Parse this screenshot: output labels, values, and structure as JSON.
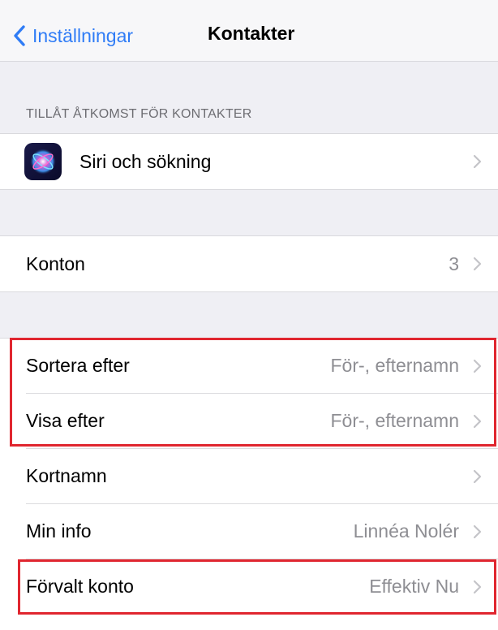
{
  "nav": {
    "back_label": "Inställningar",
    "title": "Kontakter"
  },
  "section_header": "TILLÅT ÅTKOMST FÖR KONTAKTER",
  "siri_row": {
    "label": "Siri och sökning"
  },
  "accounts_row": {
    "label": "Konton",
    "value": "3"
  },
  "settings_rows": [
    {
      "label": "Sortera efter",
      "value": "För-, efternamn"
    },
    {
      "label": "Visa efter",
      "value": "För-, efternamn"
    },
    {
      "label": "Kortnamn",
      "value": ""
    },
    {
      "label": "Min info",
      "value": "Linnéa Nolér"
    },
    {
      "label": "Förvalt konto",
      "value": "Effektiv Nu"
    }
  ],
  "colors": {
    "accent": "#2f7cf6",
    "highlight": "#e0262f",
    "background": "#efeff4",
    "secondary_text": "#8e8e93"
  },
  "icons": {
    "back": "chevron-left-icon",
    "disclosure": "chevron-right-icon",
    "siri": "siri-icon"
  }
}
